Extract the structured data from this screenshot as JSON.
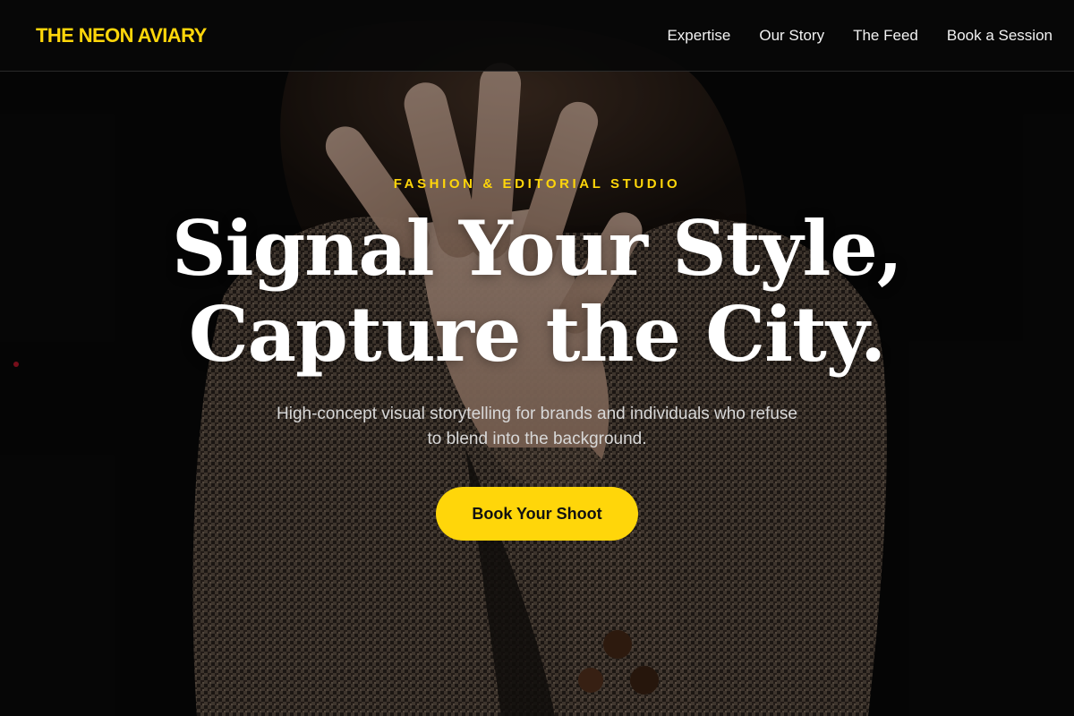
{
  "brand": {
    "name": "THE NEON AVIARY",
    "accent_color": "#ffd60a"
  },
  "nav": {
    "items": [
      {
        "label": "Expertise"
      },
      {
        "label": "Our Story"
      },
      {
        "label": "The Feed"
      },
      {
        "label": "Book a Session"
      }
    ]
  },
  "hero": {
    "eyebrow": "FASHION & EDITORIAL STUDIO",
    "headline_line1": "Signal Your Style,",
    "headline_line2": "Capture the City.",
    "subtitle_line1": "High-concept visual storytelling for brands and individuals who refuse",
    "subtitle_line2": "to blend into the background.",
    "cta_label": "Book Your Shoot",
    "background": "photo of a person in a houndstooth blazer covering their face with a hand"
  }
}
